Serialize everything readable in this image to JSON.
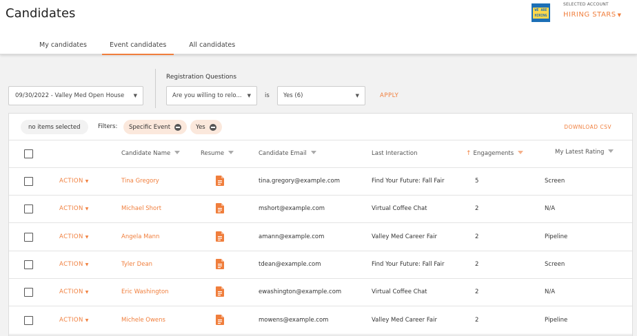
{
  "header": {
    "title": "Candidates",
    "tabs": [
      {
        "label": "My candidates",
        "active": false
      },
      {
        "label": "Event candidates",
        "active": true
      },
      {
        "label": "All candidates",
        "active": false
      }
    ],
    "logo_lines": [
      "WE ARE",
      "HIRING"
    ],
    "account_label": "SELECTED ACCOUNT",
    "account_name": "HIRING STARS"
  },
  "filters_bar": {
    "event_select_value": "09/30/2022 - Valley Med Open House",
    "registration_label": "Registration Questions",
    "question_select_value": "Are you willing to relo...",
    "is_label": "is",
    "answer_select_value": "Yes (6)",
    "apply_label": "APPLY"
  },
  "toolbar": {
    "selection_label": "no items selected",
    "filters_label": "Filters:",
    "chips": [
      "Specific Event",
      "Yes"
    ],
    "download_label": "DOWNLOAD CSV"
  },
  "table": {
    "columns": {
      "name": "Candidate Name",
      "resume": "Resume",
      "email": "Candidate Email",
      "interaction": "Last Interaction",
      "engagements": "Engagements",
      "rating": "My Latest Rating"
    },
    "action_label": "ACTION",
    "rows": [
      {
        "name": "Tina Gregory",
        "email": "tina.gregory@example.com",
        "interaction": "Find Your Future: Fall Fair",
        "engagements": "5",
        "rating": "Screen"
      },
      {
        "name": "Michael Short",
        "email": "mshort@example.com",
        "interaction": "Virtual Coffee Chat",
        "engagements": "2",
        "rating": "N/A"
      },
      {
        "name": "Angela Mann",
        "email": "amann@example.com",
        "interaction": "Valley Med Career Fair",
        "engagements": "2",
        "rating": "Pipeline"
      },
      {
        "name": "Tyler Dean",
        "email": "tdean@example.com",
        "interaction": "Find Your Future: Fall Fair",
        "engagements": "2",
        "rating": "Screen"
      },
      {
        "name": "Eric Washington",
        "email": "ewashington@example.com",
        "interaction": "Virtual Coffee Chat",
        "engagements": "2",
        "rating": "N/A"
      },
      {
        "name": "Michele Owens",
        "email": "mowens@example.com",
        "interaction": "Valley Med Career Fair",
        "engagements": "2",
        "rating": "Pipeline"
      }
    ]
  },
  "colors": {
    "accent": "#f07e3c",
    "chip_bg": "#fbe8dc",
    "logo_blue": "#1c6fb6",
    "logo_yellow": "#ffd84a"
  },
  "icons": {
    "resume": "document-icon",
    "sort": "arrow-up-icon",
    "filter": "filter-funnel-icon",
    "remove_chip": "minus-circle-icon",
    "dropdown": "caret-down-icon"
  }
}
